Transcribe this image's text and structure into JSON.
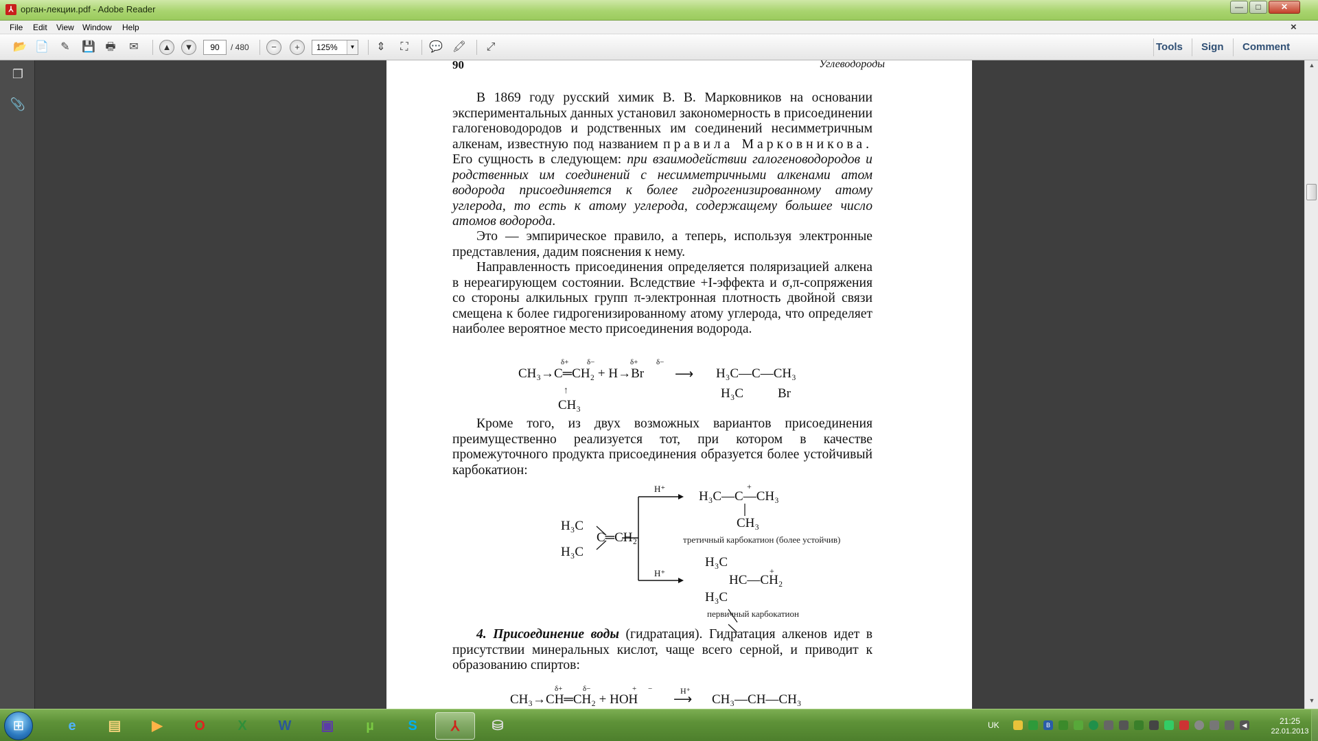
{
  "window": {
    "title": "орган-лекции.pdf - Adobe Reader",
    "minimize": "—",
    "maximize": "□",
    "close": "✕"
  },
  "menu": {
    "items": [
      "File",
      "Edit",
      "View",
      "Window",
      "Help"
    ],
    "close_doc": "×"
  },
  "toolbar": {
    "page_current": "90",
    "page_total": "/ 480",
    "zoom": "125%",
    "tools_label": "Tools",
    "sign_label": "Sign",
    "comment_label": "Comment"
  },
  "page": {
    "number": "90",
    "header": "Углеводороды",
    "p1_a": "В 1869 году русский химик В. В. Марковников на основании экспериментальных данных установил закономерность в присоединении галогеноводородов и родственных им соединений несимметричным алкенам, известную под названием",
    "p1_spaced": "правила Марковникова.",
    "p1_b": "Его сущность в следующем:",
    "p1_italic": "при взаимодействии галогеноводородов и родственных им соединений с несимметричными алкенами атом водорода присоединяется к более гидрогенизированному атому углерода, то есть к атому углерода, содержащему большее число атомов водорода",
    "p1_end": ".",
    "p2": "Это — эмпирическое правило, а теперь, используя электронные представления, дадим пояснения к нему.",
    "p3": "Направленность присоединения определяется поляризацией алкена в нереагирующем состоянии. Вследствие +I-эффекта и σ,π-сопряжения со стороны алкильных групп π-электронная плотность двойной связи смещена к более гидрогенизированному атому углерода, что определяет наиболее вероятное место присоединения водорода.",
    "p4": "Кроме того, из двух возможных вариантов присоединения преимущественно реализуется тот, при котором в качестве промежуточного продукта присоединения образуется более устойчивый карбокатион:",
    "p5_bold": "4. Присоединение воды",
    "p5": "(гидратация). Гидратация алкенов идет в присутствии минеральных кислот, чаще всего серной, и приводит к образованию спиртов:",
    "scheme1": {
      "left": "CH₃→C═CH₂ + H→Br",
      "delta1": "δ+",
      "delta2": "δ−",
      "delta3": "δ+",
      "delta4": "δ−",
      "sub_ch3": "CH₃",
      "prod_top": "H₃C—C—CH₃",
      "prod_h3c": "H₃C",
      "prod_br": "Br"
    },
    "scheme2": {
      "reactant_top": "H₃C",
      "reactant_mid": "C═CH₂",
      "reactant_bot": "H₃C",
      "h_plus": "H⁺",
      "tert_top": "H₃C—C—CH₃",
      "tert_plus": "+",
      "tert_sub": "CH₃",
      "tert_label": "третичный карбокатион (более устойчив)",
      "prim_a": "H₃C",
      "prim_b": "HC—CH₂",
      "prim_plus": "+",
      "prim_c": "H₃C",
      "prim_label": "первичный карбокатион"
    },
    "scheme3": {
      "left": "CH₃→CH═CH₂ + HOH",
      "delta_a": "δ+",
      "delta_b": "δ−",
      "plus": "+",
      "minus": "−",
      "catalyst": "H⁺",
      "right": "CH₃—CH—CH₃"
    }
  },
  "taskbar": {
    "language": "UK",
    "time": "21:25",
    "date": "22.01.2013"
  },
  "colors": {
    "titlebar": "#a9d46f",
    "taskbar": "#5e9238",
    "doc_background": "#3e3e3e",
    "page": "#ffffff"
  }
}
